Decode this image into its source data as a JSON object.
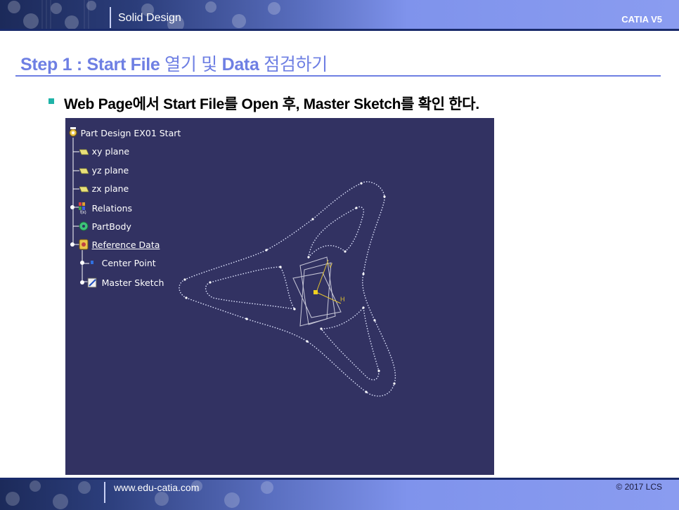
{
  "header": {
    "section": "Solid Design",
    "brand": "CATIA V5"
  },
  "title": {
    "part1": "Step 1 : Start File",
    "part2": " 열기 및 ",
    "part3": "Data",
    "part4": " 점검하기"
  },
  "bullet": {
    "text": "Web Page에서 Start File를 Open 후, Master Sketch를 확인 한다."
  },
  "tree": {
    "root": "Part Design EX01 Start",
    "items": [
      {
        "label": "xy plane"
      },
      {
        "label": "yz plane"
      },
      {
        "label": "zx plane"
      },
      {
        "label": "Relations"
      },
      {
        "label": "PartBody"
      },
      {
        "label": "Reference Data"
      },
      {
        "label": "Center Point"
      },
      {
        "label": "Master Sketch"
      }
    ]
  },
  "sketch": {
    "axis_v": "V",
    "axis_h": "H"
  },
  "footer": {
    "url": "www.edu-catia.com",
    "copyright": "© 2017 LCS"
  },
  "colors": {
    "title": "#6e7fe3",
    "viewport_bg": "#323262",
    "accent_bullet": "#1fb3a8"
  }
}
